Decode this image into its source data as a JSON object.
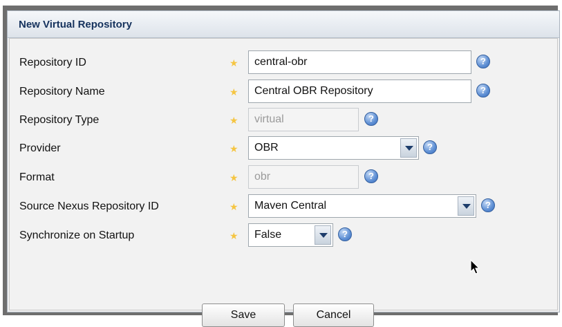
{
  "panel": {
    "title": "New Virtual Repository"
  },
  "form": {
    "repository_id": {
      "label": "Repository ID",
      "value": "central-obr",
      "help": "?"
    },
    "repository_name": {
      "label": "Repository Name",
      "value": "Central OBR Repository",
      "help": "?"
    },
    "repository_type": {
      "label": "Repository Type",
      "value": "virtual",
      "help": "?"
    },
    "provider": {
      "label": "Provider",
      "value": "OBR",
      "help": "?"
    },
    "format": {
      "label": "Format",
      "value": "obr",
      "help": "?"
    },
    "source_nexus_repository_id": {
      "label": "Source Nexus Repository ID",
      "value": "Maven Central",
      "help": "?"
    },
    "synchronize_on_startup": {
      "label": "Synchronize on Startup",
      "value": "False",
      "help": "?"
    },
    "required_marker": "★"
  },
  "buttons": {
    "save": "Save",
    "cancel": "Cancel"
  },
  "icons": {
    "required": "star-icon",
    "help": "help-icon",
    "dropdown": "chevron-down-icon",
    "cursor": "mouse-pointer-icon"
  },
  "colors": {
    "header_title": "#15325d",
    "required_star": "#f5c542",
    "help_icon": "#5e8fd4",
    "disabled_text": "#9a9a9a"
  }
}
